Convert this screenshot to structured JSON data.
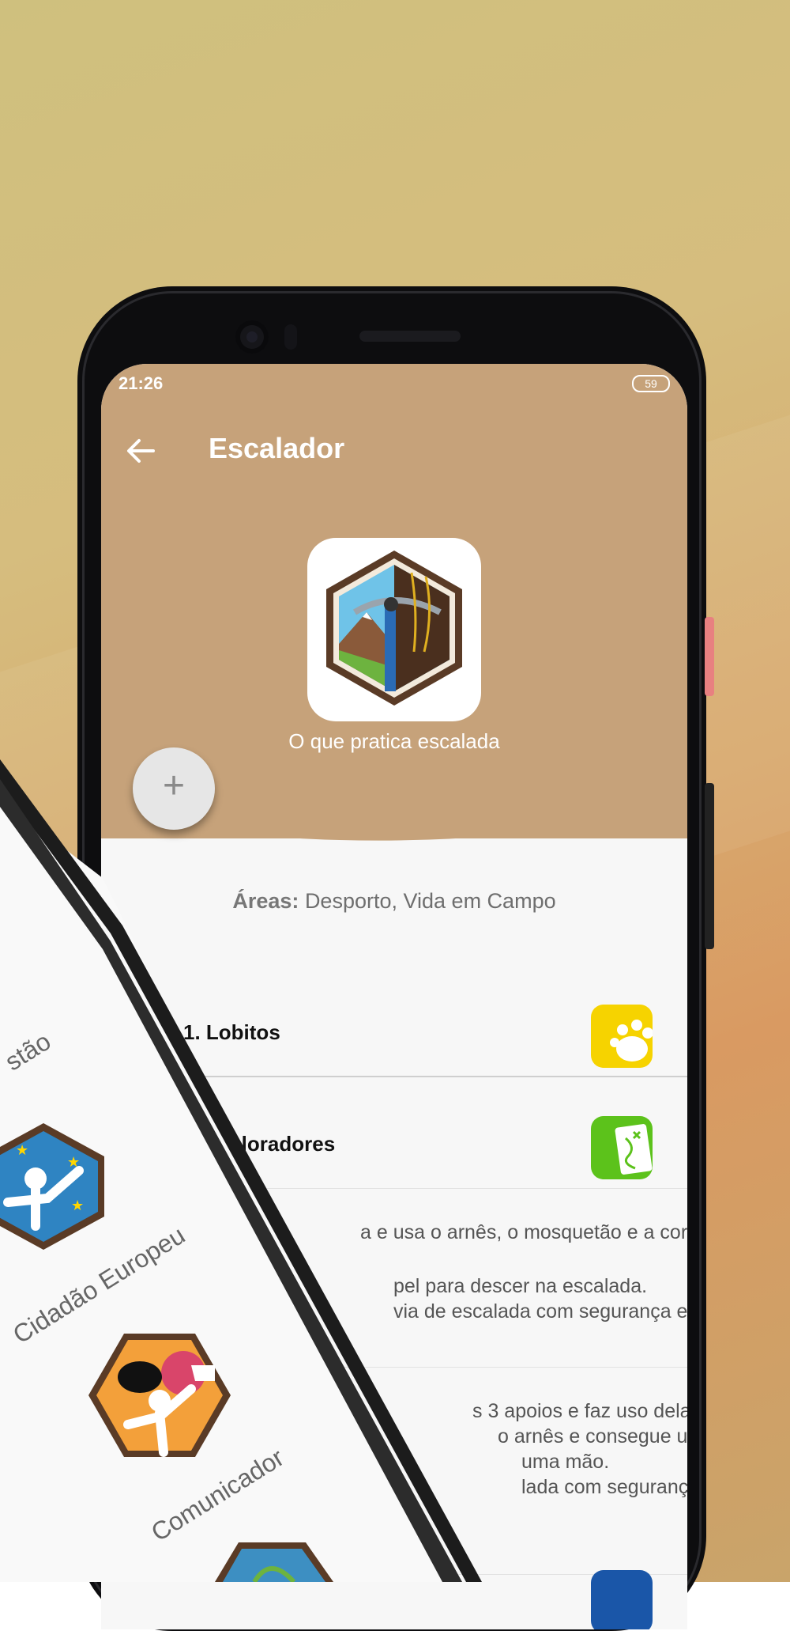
{
  "status": {
    "time": "21:26",
    "battery": "59"
  },
  "header": {
    "title": "Escalador",
    "subtitle": "O que pratica escalada"
  },
  "areas": {
    "label": "Áreas:",
    "value": "Desporto, Vida em Campo"
  },
  "sections": [
    {
      "label": "1. Lobitos",
      "icon": "paw-icon",
      "color": "#f6d300"
    },
    {
      "label": "Exploradores",
      "icon": "map-icon",
      "color": "#5cc21b"
    }
  ],
  "details": {
    "line1": "a e usa o arnês, o mosquetão e a corda de",
    "line2": "pel para descer na escalada.",
    "line3": "via de escalada com segurança em",
    "line4": "s 3 apoios e faz uso dela.",
    "line5": "o arnês e consegue usar um",
    "line6": "uma mão.",
    "line7": "lada com segurança em"
  },
  "overlay": {
    "partial_label": "stão",
    "badge1": "Cidadão Europeu",
    "badge2": "Comunicador"
  },
  "colors": {
    "header": "#c6a27a",
    "fab": "#e6e6e6"
  }
}
